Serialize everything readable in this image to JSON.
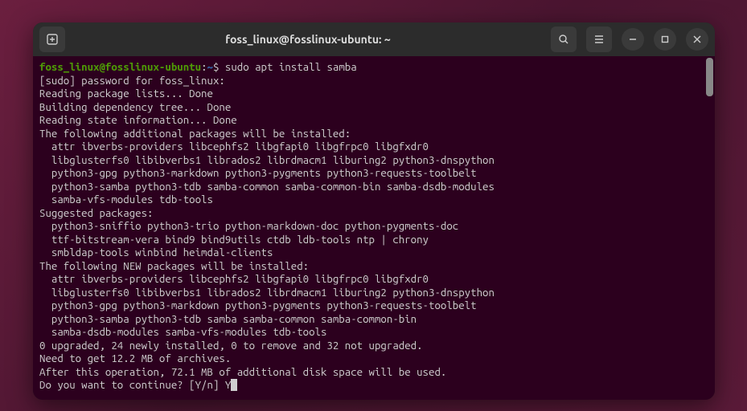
{
  "titlebar": {
    "title": "foss_linux@fosslinux-ubuntu: ~"
  },
  "prompt": {
    "user_host": "foss_linux@fosslinux-ubuntu",
    "sep1": ":",
    "path": "~",
    "sep2": "$ ",
    "command": "sudo apt install samba"
  },
  "lines": {
    "l0": "[sudo] password for foss_linux:",
    "l1": "Reading package lists... Done",
    "l2": "Building dependency tree... Done",
    "l3": "Reading state information... Done",
    "l4": "The following additional packages will be installed:",
    "l5": "  attr ibverbs-providers libcephfs2 libgfapi0 libgfrpc0 libgfxdr0",
    "l6": "  libglusterfs0 libibverbs1 librados2 librdmacm1 liburing2 python3-dnspython",
    "l7": "  python3-gpg python3-markdown python3-pygments python3-requests-toolbelt",
    "l8": "  python3-samba python3-tdb samba-common samba-common-bin samba-dsdb-modules",
    "l9": "  samba-vfs-modules tdb-tools",
    "l10": "Suggested packages:",
    "l11": "  python3-sniffio python3-trio python-markdown-doc python-pygments-doc",
    "l12": "  ttf-bitstream-vera bind9 bind9utils ctdb ldb-tools ntp | chrony",
    "l13": "  smbldap-tools winbind heimdal-clients",
    "l14": "The following NEW packages will be installed:",
    "l15": "  attr ibverbs-providers libcephfs2 libgfapi0 libgfrpc0 libgfxdr0",
    "l16": "  libglusterfs0 libibverbs1 librados2 librdmacm1 liburing2 python3-dnspython",
    "l17": "  python3-gpg python3-markdown python3-pygments python3-requests-toolbelt",
    "l18": "  python3-samba python3-tdb samba samba-common samba-common-bin",
    "l19": "  samba-dsdb-modules samba-vfs-modules tdb-tools",
    "l20": "0 upgraded, 24 newly installed, 0 to remove and 32 not upgraded.",
    "l21": "Need to get 12.2 MB of archives.",
    "l22": "After this operation, 72.1 MB of additional disk space will be used.",
    "l23": "Do you want to continue? [Y/n] Y"
  }
}
